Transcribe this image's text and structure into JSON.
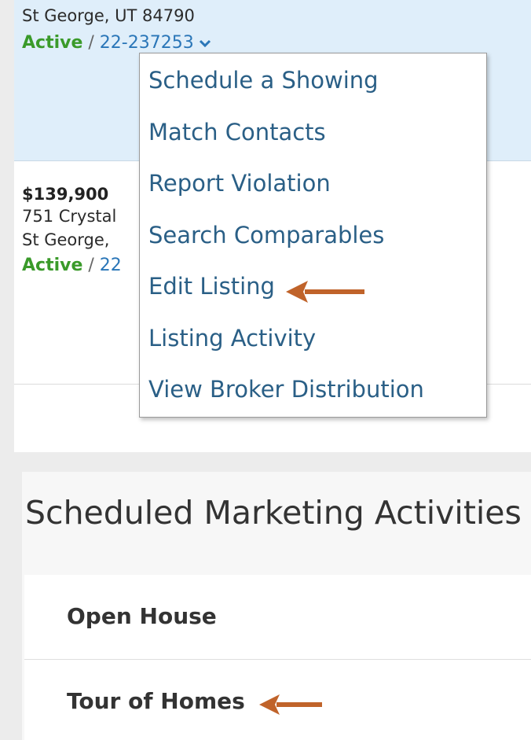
{
  "listings": [
    {
      "city_line": "St George, UT 84790",
      "status": "Active",
      "separator": " / ",
      "listing_id": "22-237253"
    },
    {
      "price": "$139,900",
      "street_line": "751 Crystal",
      "city_line": "St George,",
      "status": "Active",
      "separator": " / ",
      "listing_id": "22"
    }
  ],
  "dropdown_menu": {
    "items": [
      "Schedule a Showing",
      "Match Contacts",
      "Report Violation",
      "Search Comparables",
      "Edit Listing",
      "Listing Activity",
      "View Broker Distribution"
    ]
  },
  "marketing": {
    "title": "Scheduled Marketing Activities",
    "activities": [
      "Open House",
      "Tour of Homes"
    ]
  },
  "icons": {
    "status_toggle": "chevron-down-icon",
    "annotation": "left-arrow-icon"
  },
  "colors": {
    "active_status": "#3a9a2a",
    "link": "#2a76b8",
    "menu_text": "#2a5f86",
    "annotation_arrow": "#c0632a",
    "selected_listing_bg": "#dfeefa"
  }
}
